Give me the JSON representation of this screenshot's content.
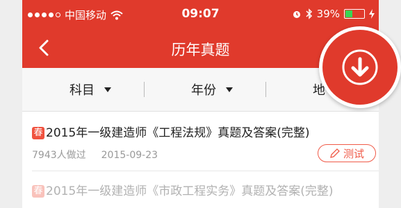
{
  "statusbar": {
    "carrier": "中国移动",
    "time": "09:07",
    "battery_text": "39%",
    "battery_level": 0.39,
    "icons": [
      "signal-dots",
      "wifi-icon",
      "alarm-icon",
      "bluetooth-icon",
      "battery-icon",
      "charging-icon"
    ]
  },
  "navbar": {
    "title": "历年真题",
    "back_icon": "chevron-left-icon",
    "action_icon": "download-icon"
  },
  "filters": [
    {
      "label": "科目"
    },
    {
      "label": "年份"
    },
    {
      "label": "地"
    }
  ],
  "items": [
    {
      "tag": "春",
      "title": "2015年一级建造师《工程法规》真题及答案(完整)",
      "count": "7943人做过",
      "date": "2015-09-23",
      "button": "测试"
    },
    {
      "tag": "春",
      "title": "2015年一级建造师《市政工程实务》真题及答案(完整)"
    }
  ],
  "colors": {
    "brand_red": "#e03a2c",
    "accent_red": "#f05a48",
    "charging_green": "#39d353"
  }
}
